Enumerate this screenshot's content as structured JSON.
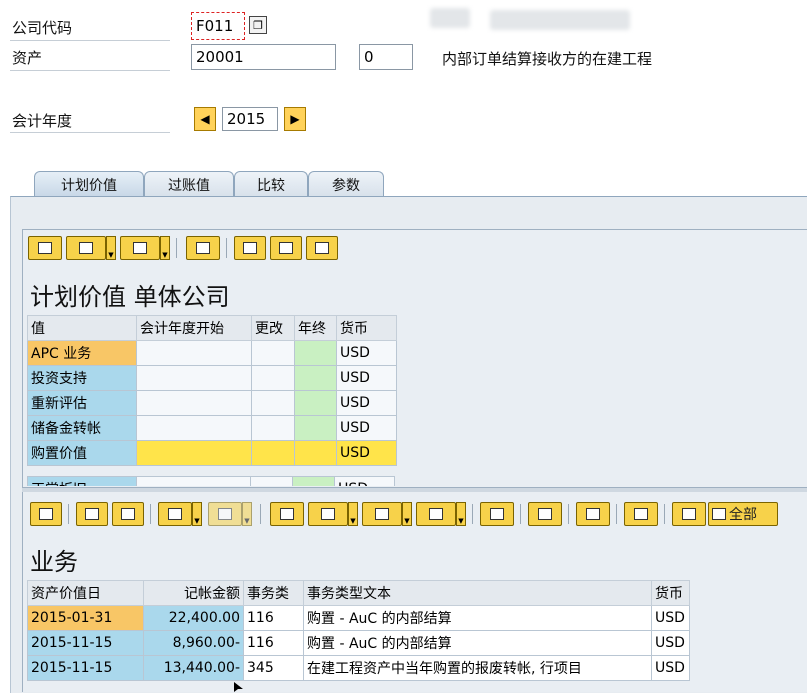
{
  "header": {
    "company_code_label": "公司代码",
    "company_code_value": "F011",
    "asset_label": "资产",
    "asset_number": "20001",
    "asset_subnumber": "0",
    "asset_description": "内部订单结算接收方的在建工程",
    "fiscal_year_label": "会计年度",
    "fiscal_year_value": "2015",
    "prev_year_glyph": "◀",
    "next_year_glyph": "▶"
  },
  "tabs": [
    {
      "label": "计划价值",
      "active": true
    },
    {
      "label": "过账值",
      "active": false
    },
    {
      "label": "比较",
      "active": false
    },
    {
      "label": "参数",
      "active": false
    }
  ],
  "planned": {
    "title": "计划价值 单体公司",
    "columns": [
      "值",
      "会计年度开始",
      "更改",
      "年终",
      "货币"
    ],
    "rows": [
      {
        "name": "APC 业务",
        "currency": "USD",
        "style": "orange"
      },
      {
        "name": "投资支持",
        "currency": "USD",
        "style": "blue"
      },
      {
        "name": "重新评估",
        "currency": "USD",
        "style": "blue"
      },
      {
        "name": "储备金转帐",
        "currency": "USD",
        "style": "blue"
      },
      {
        "name": "购置价值",
        "currency": "USD",
        "style": "yellow"
      },
      {
        "name": "正常折旧",
        "currency": "USD",
        "style": "blue"
      }
    ]
  },
  "transactions": {
    "title": "业务",
    "all_button_label": "全部",
    "columns": [
      "资产价值日",
      "记帐金额",
      "事务类",
      "事务类型文本",
      "货币"
    ],
    "rows": [
      {
        "date": "2015-01-31",
        "amount": "22,400.00",
        "type": "116",
        "text": "购置 - AuC 的内部结算",
        "currency": "USD"
      },
      {
        "date": "2015-11-15",
        "amount": "8,960.00-",
        "type": "116",
        "text": "购置 - AuC 的内部结算",
        "currency": "USD"
      },
      {
        "date": "2015-11-15",
        "amount": "13,440.00-",
        "type": "345",
        "text": "在建工程资产中当年购置的报废转帐, 行项目",
        "currency": "USD"
      }
    ]
  },
  "colors": {
    "toolbar_button": "#f7d24a",
    "row_highlight": "#f8c666",
    "row_key": "#aad8ec",
    "row_total": "#ffe44a",
    "year_end_column": "#c9f0c2",
    "panel_background": "#e7ecf1"
  },
  "icons": {
    "toolbar_top": [
      "print-icon",
      "print-preview-icon",
      "export-icon",
      "info-icon",
      "layout-icon",
      "calculator-icon",
      "graphic-icon"
    ],
    "toolbar_bottom": [
      "details-icon",
      "sort-ascending-icon",
      "filter-icon",
      "sum-icon",
      "subtotal-icon",
      "print-icon",
      "print-preview-icon",
      "export-icon",
      "layout-icon",
      "graphic-icon",
      "info-icon",
      "copy-icon",
      "print-list-icon",
      "select-layout-icon",
      "all-icon"
    ]
  }
}
